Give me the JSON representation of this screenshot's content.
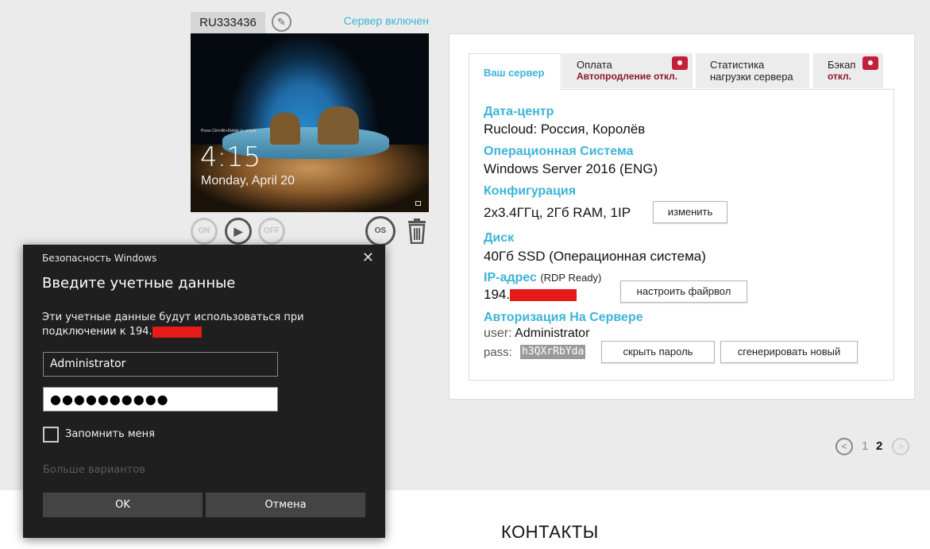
{
  "server": {
    "id": "RU333436",
    "status": "Сервер включен",
    "screen": {
      "hint": "Press Ctrl+Alt+Delete to unlock.",
      "clock": "4:15",
      "date": "Monday, April 20"
    },
    "controls": {
      "on": "ON",
      "play": "▶",
      "off": "OFF",
      "reinstall": "OS"
    }
  },
  "tabs": [
    {
      "label": "Ваш сервер",
      "sub": ""
    },
    {
      "label": "Оплата",
      "sub": "Автопродление откл."
    },
    {
      "label": "Статистика",
      "sub": "нагрузки сервера"
    },
    {
      "label": "Бэкап",
      "sub": "откл."
    }
  ],
  "details": {
    "datacenter_label": "Дата-центр",
    "datacenter_value": "Rucloud: Россия, Королёв",
    "os_label": "Операционная Система",
    "os_value": "Windows Server 2016 (ENG)",
    "config_label": "Конфигурация",
    "config_value": "2x3.4ГГц, 2Гб RAM, 1IP",
    "config_button": "изменить",
    "disk_label": "Диск",
    "disk_value": "40Гб SSD (Операционная система)",
    "ip_label": "IP-адрес",
    "ip_note": "(RDP Ready)",
    "ip_value": "194.",
    "ip_button": "настроить файрвол",
    "auth_label": "Авторизация На Сервере",
    "user_label": "user:",
    "user_value": "Administrator",
    "pass_label": "pass:",
    "pass_value": "h3QXrRbYda",
    "hide_button": "скрыть пароль",
    "generate_button": "сгенерировать новый"
  },
  "pager": {
    "prev": "<",
    "page1": "1",
    "page2": "2",
    "next": ">"
  },
  "footer": {
    "contacts": "КОНТАКТЫ"
  },
  "dialog": {
    "title": "Безопасность Windows",
    "close": "✕",
    "heading": "Введите учетные данные",
    "description": "Эти учетные данные будут использоваться при подключении к 194.",
    "username": "Administrator",
    "password_mask": "●●●●●●●●●●",
    "remember": "Запомнить меня",
    "more": "Больше вариантов",
    "ok": "OK",
    "cancel": "Отмена"
  },
  "colors": {
    "accent": "#3cb4d8",
    "alert": "#c41e3a",
    "redaction": "#e61a1a"
  }
}
